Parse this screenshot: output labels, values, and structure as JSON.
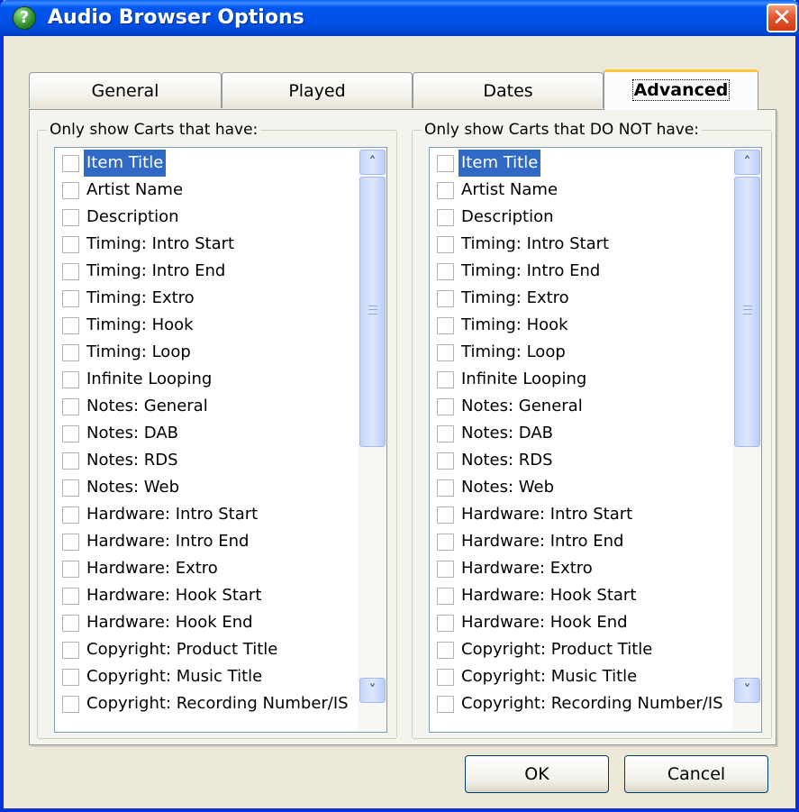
{
  "window": {
    "title": "Audio Browser Options",
    "title_icon": "help-question-icon",
    "close_icon": "close-icon",
    "close_glyph": "✕"
  },
  "tabs": [
    {
      "label": "General",
      "active": false
    },
    {
      "label": "Played",
      "active": false
    },
    {
      "label": "Dates",
      "active": false
    },
    {
      "label": "Advanced",
      "active": true
    }
  ],
  "left_group": {
    "legend": "Only show Carts that have:",
    "items": [
      {
        "label": "Item Title",
        "checked": false,
        "selected": true
      },
      {
        "label": "Artist Name",
        "checked": false
      },
      {
        "label": "Description",
        "checked": false
      },
      {
        "label": "Timing: Intro Start",
        "checked": false
      },
      {
        "label": "Timing: Intro End",
        "checked": false
      },
      {
        "label": "Timing: Extro",
        "checked": false
      },
      {
        "label": "Timing: Hook",
        "checked": false
      },
      {
        "label": "Timing: Loop",
        "checked": false
      },
      {
        "label": "Infinite Looping",
        "checked": false
      },
      {
        "label": "Notes: General",
        "checked": false
      },
      {
        "label": "Notes: DAB",
        "checked": false
      },
      {
        "label": "Notes: RDS",
        "checked": false
      },
      {
        "label": "Notes: Web",
        "checked": false
      },
      {
        "label": "Hardware: Intro Start",
        "checked": false
      },
      {
        "label": "Hardware: Intro End",
        "checked": false
      },
      {
        "label": "Hardware: Extro",
        "checked": false
      },
      {
        "label": "Hardware: Hook Start",
        "checked": false
      },
      {
        "label": "Hardware: Hook End",
        "checked": false
      },
      {
        "label": "Copyright: Product Title",
        "checked": false
      },
      {
        "label": "Copyright: Music Title",
        "checked": false
      },
      {
        "label": "Copyright: Recording Number/IS",
        "checked": false
      }
    ]
  },
  "right_group": {
    "legend": "Only show Carts that DO NOT have:",
    "items": [
      {
        "label": "Item Title",
        "checked": false,
        "selected": true
      },
      {
        "label": "Artist Name",
        "checked": false
      },
      {
        "label": "Description",
        "checked": false
      },
      {
        "label": "Timing: Intro Start",
        "checked": false
      },
      {
        "label": "Timing: Intro End",
        "checked": false
      },
      {
        "label": "Timing: Extro",
        "checked": false
      },
      {
        "label": "Timing: Hook",
        "checked": false
      },
      {
        "label": "Timing: Loop",
        "checked": false
      },
      {
        "label": "Infinite Looping",
        "checked": false
      },
      {
        "label": "Notes: General",
        "checked": false
      },
      {
        "label": "Notes: DAB",
        "checked": false
      },
      {
        "label": "Notes: RDS",
        "checked": false
      },
      {
        "label": "Notes: Web",
        "checked": false
      },
      {
        "label": "Hardware: Intro Start",
        "checked": false
      },
      {
        "label": "Hardware: Intro End",
        "checked": false
      },
      {
        "label": "Hardware: Extro",
        "checked": false
      },
      {
        "label": "Hardware: Hook Start",
        "checked": false
      },
      {
        "label": "Hardware: Hook End",
        "checked": false
      },
      {
        "label": "Copyright: Product Title",
        "checked": false
      },
      {
        "label": "Copyright: Music Title",
        "checked": false
      },
      {
        "label": "Copyright: Recording Number/IS",
        "checked": false
      }
    ]
  },
  "scrollbar": {
    "up_glyph": "˄",
    "down_glyph": "˅"
  },
  "buttons": {
    "ok_label": "OK",
    "cancel_label": "Cancel"
  },
  "colors": {
    "selection": "#316AC5",
    "titlebar": "#0054E3",
    "active_tab_accent": "#FFC83C"
  }
}
